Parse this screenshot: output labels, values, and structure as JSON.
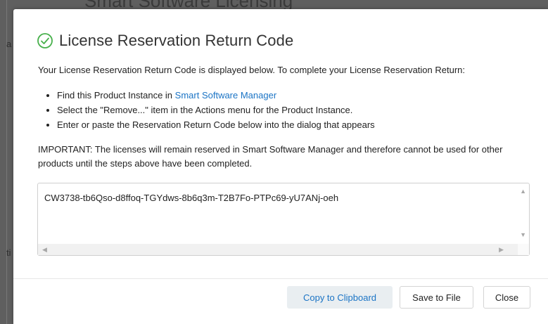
{
  "backdrop": {
    "title_fragment": "Smart Software Licensing",
    "side_a": "a",
    "side_t": "ti"
  },
  "dialog": {
    "title": "License Reservation Return Code",
    "intro": "Your License Reservation Return Code is displayed below. To complete your License Reservation Return:",
    "steps": [
      {
        "prefix": "Find this Product Instance in ",
        "link": "Smart Software Manager"
      },
      {
        "text": "Select the \"Remove...\" item in the Actions menu for the Product Instance."
      },
      {
        "text": "Enter or paste the Reservation Return Code below into the dialog that appears"
      }
    ],
    "important": "IMPORTANT: The licenses will remain reserved in Smart Software Manager and therefore cannot be used for other products until the steps above have been completed.",
    "return_code": "CW3738-tb6Qso-d8ffoq-TGYdws-8b6q3m-T2B7Fo-PTPc69-yU7ANj-oeh",
    "buttons": {
      "copy": "Copy to Clipboard",
      "save": "Save to File",
      "close": "Close"
    }
  },
  "icons": {
    "title_icon": "check-circle-icon",
    "success_color": "#47b04b",
    "link_color": "#1b74c5"
  }
}
